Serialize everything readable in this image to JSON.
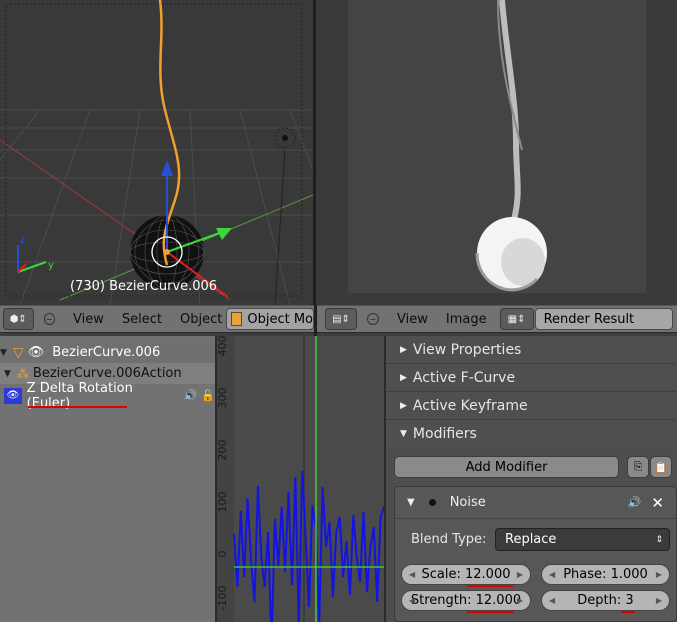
{
  "viewport3d": {
    "object_info": "(730) BezierCurve.006"
  },
  "header_left": {
    "menus": [
      "View",
      "Select",
      "Object"
    ],
    "mode_label": "Object Mo"
  },
  "header_right": {
    "menus": [
      "View",
      "Image"
    ],
    "image_name": "Render Result"
  },
  "outliner": {
    "items": [
      {
        "label": "BezierCurve.006"
      },
      {
        "label": "BezierCurve.006Action"
      },
      {
        "label": "Z Delta Rotation (Euler)"
      }
    ]
  },
  "graph": {
    "y_ticks": [
      "400",
      "300",
      "200",
      "100",
      "0",
      "-100"
    ],
    "noise_curve": [
      0.33,
      -0.2,
      0.56,
      -0.1,
      0.69,
      0.08,
      -0.35,
      0.81,
      0.1,
      -0.2,
      0.35,
      -0.8,
      0.48,
      0.0,
      0.6,
      -0.05,
      0.75,
      -0.18,
      0.9,
      -0.6,
      0.96,
      0.3,
      -0.4,
      0.62,
      0.4,
      -0.55,
      0.8,
      0.2,
      0.45,
      -0.3,
      0.35,
      0.5,
      -0.1,
      0.26,
      -0.28,
      0.52,
      0.1,
      -0.15,
      0.55,
      -0.25,
      0.2,
      0.4,
      -0.35,
      0.5,
      0.6
    ]
  },
  "properties": {
    "panels": [
      "View Properties",
      "Active F-Curve",
      "Active Keyframe",
      "Modifiers"
    ],
    "add_modifier": "Add Modifier",
    "modifier": {
      "name": "Noise",
      "blend_type_label": "Blend Type:",
      "blend_type_value": "Replace",
      "scale_label": "Scale:",
      "scale_value": "12.000",
      "phase_label": "Phase:",
      "phase_value": "1.000",
      "strength_label": "Strength:",
      "strength_value": "12.000",
      "depth_label": "Depth:",
      "depth_value": "3"
    }
  },
  "colors": {
    "curve_selected": "#f0a030",
    "fcurve": "#1010e0",
    "current_frame": "#44dd33",
    "annotation": "#e00000"
  }
}
